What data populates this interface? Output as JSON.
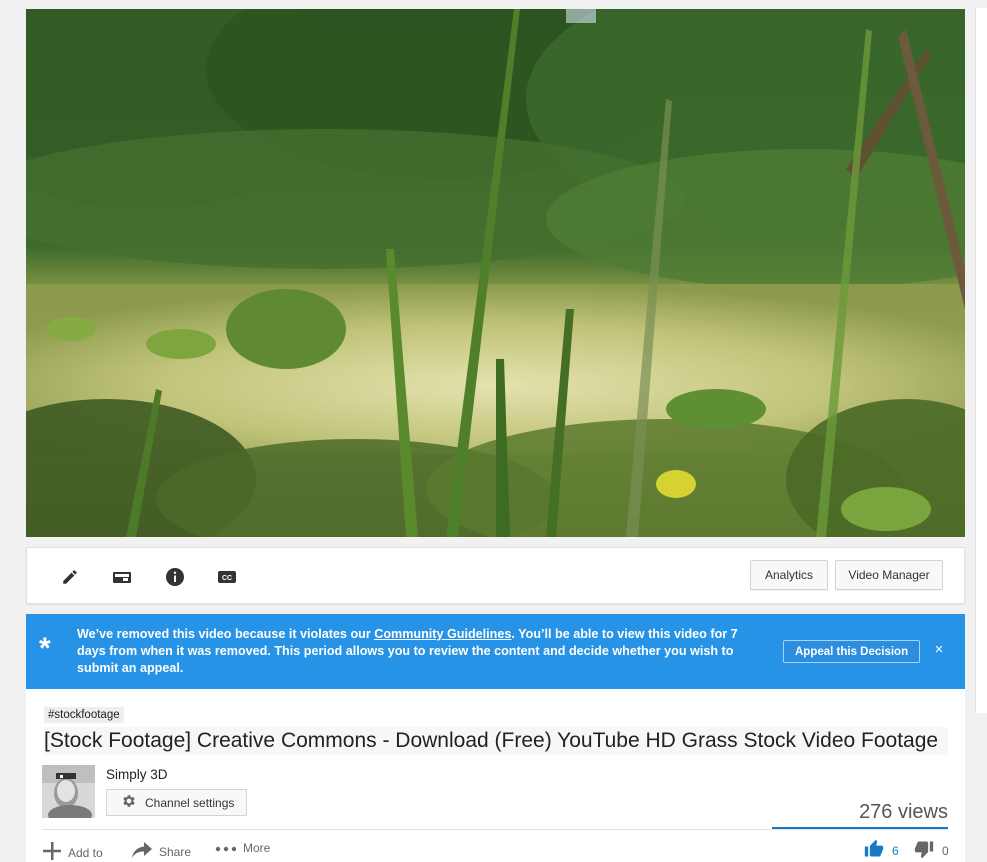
{
  "video": {
    "description_icons": [
      "pencil-icon",
      "enhance-icon",
      "info-icon",
      "cc-icon"
    ]
  },
  "toolbar": {
    "analytics_label": "Analytics",
    "video_manager_label": "Video Manager"
  },
  "notice": {
    "text_before": "We’ve removed this video because it violates our ",
    "link_text": "Community Guidelines",
    "text_after": ". You’ll be able to view this video for 7 days from when it was removed. This period allows you to review the content and decide whether you wish to submit an appeal.",
    "appeal_label": "Appeal this Decision",
    "close_glyph": "×",
    "star_glyph": "*",
    "color": "#2793e6"
  },
  "info": {
    "hashtag": "#stockfootage",
    "title": "[Stock Footage] Creative Commons - Download (Free) YouTube HD Grass Stock Video Footage",
    "channel_name": "Simply 3D",
    "channel_settings_label": "Channel settings",
    "views": "276 views",
    "actions": {
      "add_to": "Add to",
      "share": "Share",
      "more": "More"
    },
    "likes": "6",
    "dislikes": "0",
    "accent_color": "#167ac6"
  }
}
